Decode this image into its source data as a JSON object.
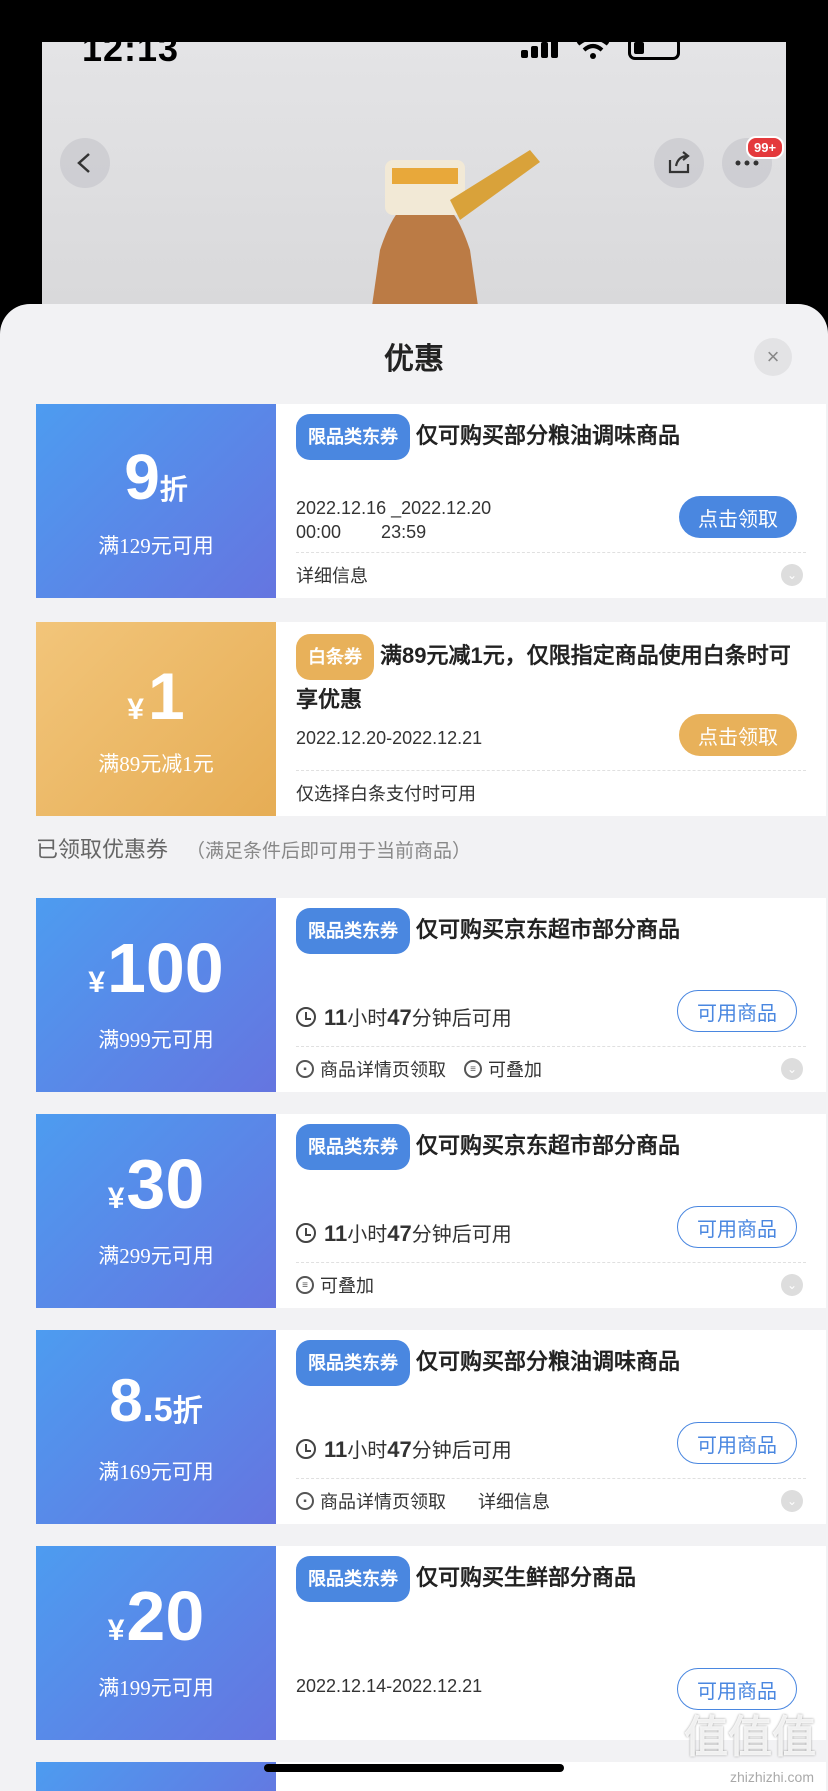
{
  "status": {
    "time": "12:13"
  },
  "header": {
    "badge": "99+"
  },
  "sheet": {
    "title": "优惠",
    "close": "×"
  },
  "coupons_top": [
    {
      "big": "9",
      "unit": "折",
      "cond": "满129元可用",
      "tag": "限品类东券",
      "title": "仅可购买部分粮油调味商品",
      "date_line1": "2022.12.16 _2022.12.20",
      "date_line2": "00:00        23:59",
      "action": "点击领取",
      "foot": "详细信息"
    },
    {
      "big": "1",
      "currency": "¥",
      "cond": "满89元减1元",
      "tag": "白条券",
      "title": "满89元减1元，仅限指定商品使用白条时可享优惠",
      "date": "2022.12.20-2022.12.21",
      "action": "点击领取",
      "foot": "仅选择白条支付时可用"
    }
  ],
  "section": {
    "label": "已领取优惠券",
    "sub": "（满足条件后即可用于当前商品）"
  },
  "coupons_received": [
    {
      "currency": "¥",
      "big": "100",
      "cond": "满999元可用",
      "tag": "限品类东券",
      "title": "仅可购买京东超市部分商品",
      "hours": "11",
      "h_unit": "小时",
      "mins": "47",
      "m_unit": "分钟后可用",
      "action": "可用商品",
      "foot1": "商品详情页领取",
      "foot2": "可叠加"
    },
    {
      "currency": "¥",
      "big": "30",
      "cond": "满299元可用",
      "tag": "限品类东券",
      "title": "仅可购买京东超市部分商品",
      "hours": "11",
      "h_unit": "小时",
      "mins": "47",
      "m_unit": "分钟后可用",
      "action": "可用商品",
      "foot1": "可叠加"
    },
    {
      "big": "8",
      "dot": ".",
      "small": "5",
      "unit": "折",
      "cond": "满169元可用",
      "tag": "限品类东券",
      "title": "仅可购买部分粮油调味商品",
      "hours": "11",
      "h_unit": "小时",
      "mins": "47",
      "m_unit": "分钟后可用",
      "action": "可用商品",
      "foot1": "商品详情页领取",
      "foot2": "详细信息"
    },
    {
      "currency": "¥",
      "big": "20",
      "cond": "满199元可用",
      "tag": "限品类东券",
      "title": "仅可购买生鲜部分商品",
      "date": "2022.12.14-2022.12.21",
      "action": "可用商品"
    }
  ],
  "watermark": {
    "main": "值值值",
    "sub": "zhizhizhi.com"
  }
}
